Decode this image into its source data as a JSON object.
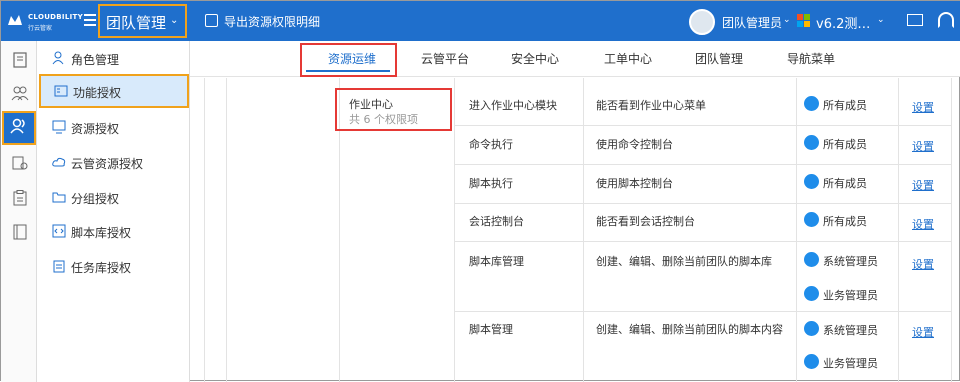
{
  "header": {
    "brand": "CLOUDBILITY",
    "brand_sub": "行云管家",
    "team_label": "团队管理",
    "export_label": "导出资源权限明细",
    "user_name": "团队管理员",
    "version": "v6.2测…"
  },
  "submenu": [
    {
      "label": "角色管理",
      "icon": "roles-icon"
    },
    {
      "label": "功能授权",
      "icon": "function-auth-icon",
      "active": true
    },
    {
      "label": "资源授权",
      "icon": "monitor-icon"
    },
    {
      "label": "云管资源授权",
      "icon": "cloud-icon"
    },
    {
      "label": "分组授权",
      "icon": "folder-icon"
    },
    {
      "label": "脚本库授权",
      "icon": "code-file-icon"
    },
    {
      "label": "任务库授权",
      "icon": "task-icon"
    }
  ],
  "tabs": [
    "资源运维",
    "云管平台",
    "安全中心",
    "工单中心",
    "团队管理",
    "导航菜单"
  ],
  "active_tab": "资源运维",
  "category": {
    "name": "作业中心",
    "count_text": "共 6 个权限项"
  },
  "rows": [
    {
      "name": "进入作业中心模块",
      "desc": "能否看到作业中心菜单",
      "members": [
        "所有成员"
      ],
      "action": "设置"
    },
    {
      "name": "命令执行",
      "desc": "使用命令控制台",
      "members": [
        "所有成员"
      ],
      "action": "设置"
    },
    {
      "name": "脚本执行",
      "desc": "使用脚本控制台",
      "members": [
        "所有成员"
      ],
      "action": "设置"
    },
    {
      "name": "会话控制台",
      "desc": "能否看到会话控制台",
      "members": [
        "所有成员"
      ],
      "action": "设置"
    },
    {
      "name": "脚本库管理",
      "desc": "创建、编辑、删除当前团队的脚本库",
      "members": [
        "系统管理员",
        "业务管理员"
      ],
      "action": "设置"
    },
    {
      "name": "脚本管理",
      "desc": "创建、编辑、删除当前团队的脚本内容",
      "members": [
        "系统管理员",
        "业务管理员"
      ],
      "action": "设置"
    }
  ],
  "colors": {
    "primary": "#1f6fcc",
    "highlight_orange": "#f0a21c",
    "highlight_red": "#e53935"
  }
}
